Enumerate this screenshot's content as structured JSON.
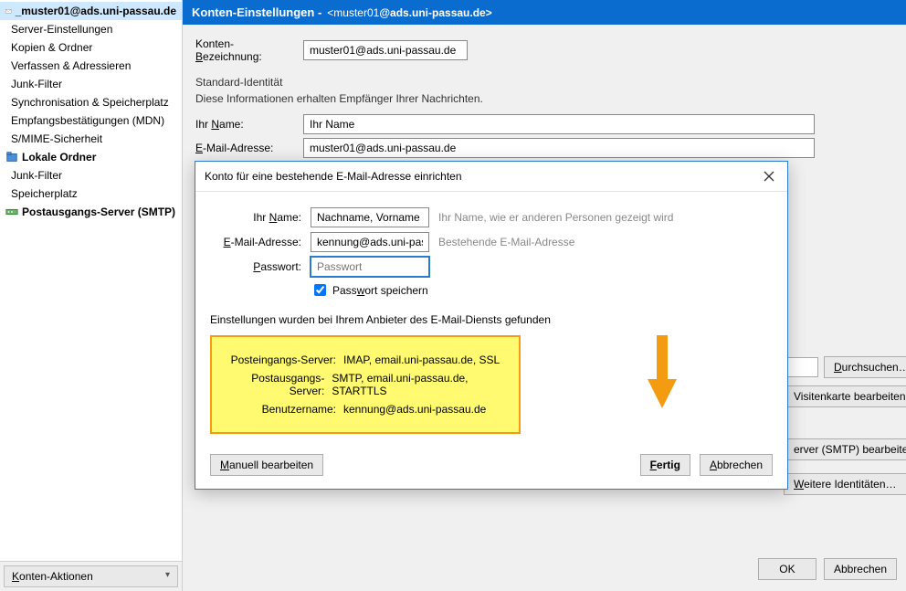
{
  "sidebar": {
    "items": [
      {
        "label": "_muster01@ads.uni-passau.de",
        "bold": true,
        "selected": true,
        "icon": "account"
      },
      {
        "label": "Server-Einstellungen"
      },
      {
        "label": "Kopien & Ordner"
      },
      {
        "label": "Verfassen & Adressieren"
      },
      {
        "label": "Junk-Filter"
      },
      {
        "label": "Synchronisation & Speicherplatz"
      },
      {
        "label": "Empfangsbestätigungen (MDN)"
      },
      {
        "label": "S/MIME-Sicherheit"
      },
      {
        "label": "Lokale Ordner",
        "bold": true,
        "icon": "folder"
      },
      {
        "label": "Junk-Filter"
      },
      {
        "label": "Speicherplatz"
      },
      {
        "label": "Postausgangs-Server (SMTP)",
        "bold": true,
        "icon": "smtp"
      }
    ],
    "actions_label": "Konten-Aktionen"
  },
  "header": {
    "title": "Konten-Einstellungen - ",
    "email_prefix": "<muster01",
    "email_bold": "@ads.uni-passau.de>"
  },
  "main": {
    "acct_label": "Konten-Bezeichnung:",
    "acct_value": "muster01@ads.uni-passau.de",
    "identity_title": "Standard-Identität",
    "identity_desc": "Diese Informationen erhalten Empfänger Ihrer Nachrichten.",
    "name_label": "Ihr Name:",
    "name_value": "Ihr Name",
    "email_label": "E-Mail-Adresse:",
    "email_value": "muster01@ads.uni-passau.de",
    "browse_label": "Durchsuchen…",
    "vcard_label": "Visitenkarte bearbeiten…",
    "smtp_edit_label": "erver (SMTP) bearbeiten…",
    "more_ids_label": "Weitere Identitäten…",
    "ok_label": "OK",
    "cancel_label": "Abbrechen"
  },
  "dialog": {
    "title": "Konto für eine bestehende E-Mail-Adresse einrichten",
    "name_label": "Ihr Name:",
    "name_value": "Nachname, Vorname",
    "name_hint": "Ihr Name, wie er anderen Personen gezeigt wird",
    "email_label": "E-Mail-Adresse:",
    "email_value": "kennung@ads.uni-pas",
    "email_hint": "Bestehende E-Mail-Adresse",
    "password_label": "Passwort:",
    "password_placeholder": "Passwort",
    "remember_label": "Passwort speichern",
    "found_text": "Einstellungen wurden bei Ihrem Anbieter des E-Mail-Diensts gefunden",
    "incoming_label": "Posteingangs-Server:",
    "incoming_value": "IMAP, email.uni-passau.de, SSL",
    "outgoing_label": "Postausgangs-Server:",
    "outgoing_value": "SMTP, email.uni-passau.de, STARTTLS",
    "user_label": "Benutzername:",
    "user_value": "kennung@ads.uni-passau.de",
    "manual_label": "Manuell bearbeiten",
    "done_label": "Fertig",
    "cancel_label": "Abbrechen"
  }
}
